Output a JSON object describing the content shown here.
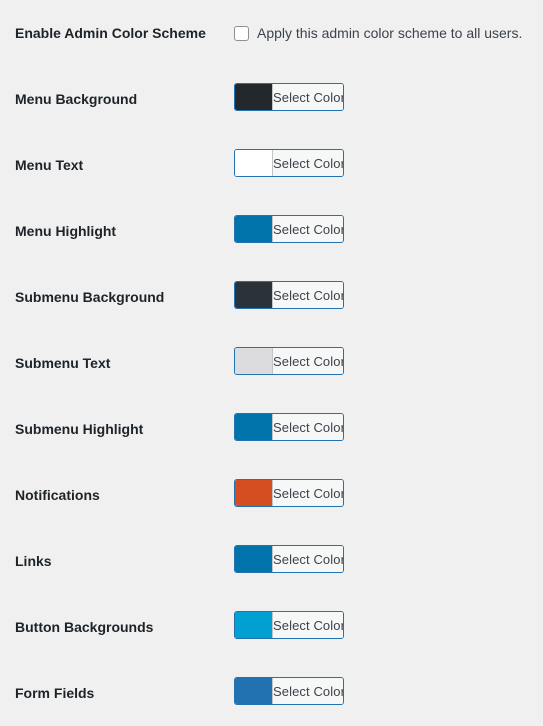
{
  "form": {
    "enable_row": {
      "label": "Enable Admin Color Scheme",
      "checkbox_label": "Apply this admin color scheme to all users.",
      "checked": false
    },
    "button_label": "Select Color",
    "rows": [
      {
        "label": "Menu Background",
        "color": "#23282d"
      },
      {
        "label": "Menu Text",
        "color": "#ffffff"
      },
      {
        "label": "Menu Highlight",
        "color": "#0073aa"
      },
      {
        "label": "Submenu Background",
        "color": "#2c3338"
      },
      {
        "label": "Submenu Text",
        "color": "#dcdcde"
      },
      {
        "label": "Submenu Highlight",
        "color": "#0073aa"
      },
      {
        "label": "Notifications",
        "color": "#d54e21"
      },
      {
        "label": "Links",
        "color": "#0073aa"
      },
      {
        "label": "Button Backgrounds",
        "color": "#00a0d2"
      },
      {
        "label": "Form Fields",
        "color": "#2271b1"
      }
    ]
  },
  "theme": {
    "page_background": "#f0f0f1",
    "label_color": "#1d2327",
    "button_border": "#2271b1",
    "button_face": "#f6f7f7",
    "button_text": "#3c434a"
  }
}
